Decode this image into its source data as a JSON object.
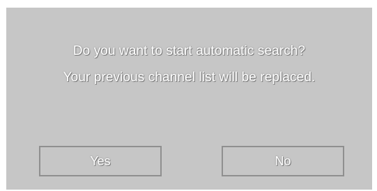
{
  "dialog": {
    "message_line1": "Do you want to start automatic search?",
    "message_line2": "Your previous channel list will be replaced.",
    "yes_label": "Yes",
    "no_label": "No"
  },
  "colors": {
    "dialog_background": "#c6c6c6",
    "text": "#ffffff",
    "button_border": "#8f8f8f"
  }
}
